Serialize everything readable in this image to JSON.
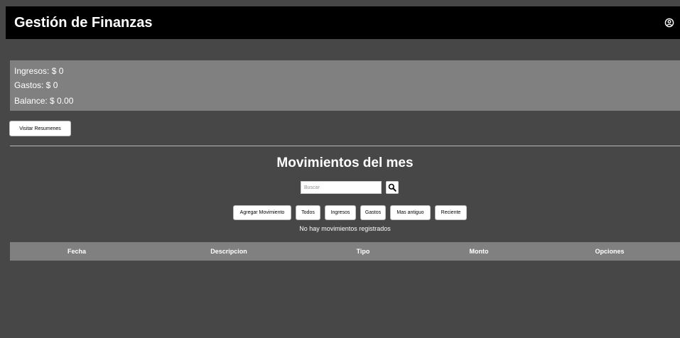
{
  "header": {
    "title": "Gestión de Finanzas",
    "user_icon": "user-circle-icon"
  },
  "summary": {
    "ingresos": "Ingresos: $ 0",
    "gastos": "Gastos: $ 0",
    "balance": "Balance: $ 0.00"
  },
  "buttons": {
    "visit_summaries": "Visitar Resumenes"
  },
  "movements": {
    "title": "Movimientos del mes",
    "search": {
      "placeholder": "Buscar",
      "value": "",
      "icon": "search-icon"
    },
    "filters": {
      "add": "Agregar Movimiento",
      "all": "Todos",
      "income": "Ingresos",
      "expenses": "Gastos",
      "oldest": "Mas antiguo",
      "recent": "Reciente"
    },
    "empty_message": "No hay movimientos registrados"
  },
  "table": {
    "columns": [
      "Fecha",
      "Descripcion",
      "Tipo",
      "Monto",
      "Opciones"
    ]
  },
  "colors": {
    "background": "#474747",
    "header_bar": "#000000",
    "panel": "#808080",
    "text": "#ffffff"
  }
}
